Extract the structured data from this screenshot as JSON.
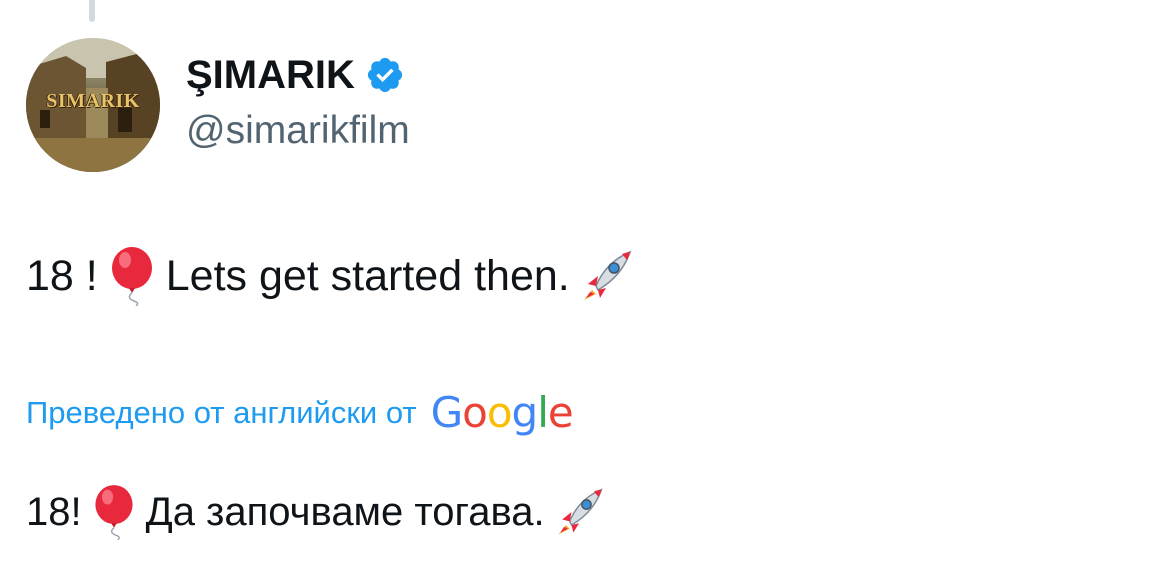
{
  "author": {
    "display_name": "ŞIMARIK",
    "handle": "@simarikfilm",
    "avatar_text": "SIMARIK",
    "verified_icon": "verified-badge-icon",
    "verified_color": "#1d9bf0"
  },
  "tweet": {
    "part1": "18 !",
    "emoji1": "balloon",
    "part2": "Lets get started then.",
    "emoji2": "rocket"
  },
  "translation": {
    "label": "Преведено от английски от",
    "provider_letters": [
      "G",
      "o",
      "o",
      "g",
      "l",
      "e"
    ],
    "provider_colors": [
      "#4285f4",
      "#ea4335",
      "#fbbc05",
      "#4285f4",
      "#34a853",
      "#ea4335"
    ],
    "part1": "18!",
    "emoji1": "balloon",
    "part2": "Да започваме тогава.",
    "emoji2": "rocket"
  },
  "colors": {
    "link": "#1d9bf0",
    "text": "#0f1419",
    "secondary": "#536471"
  }
}
